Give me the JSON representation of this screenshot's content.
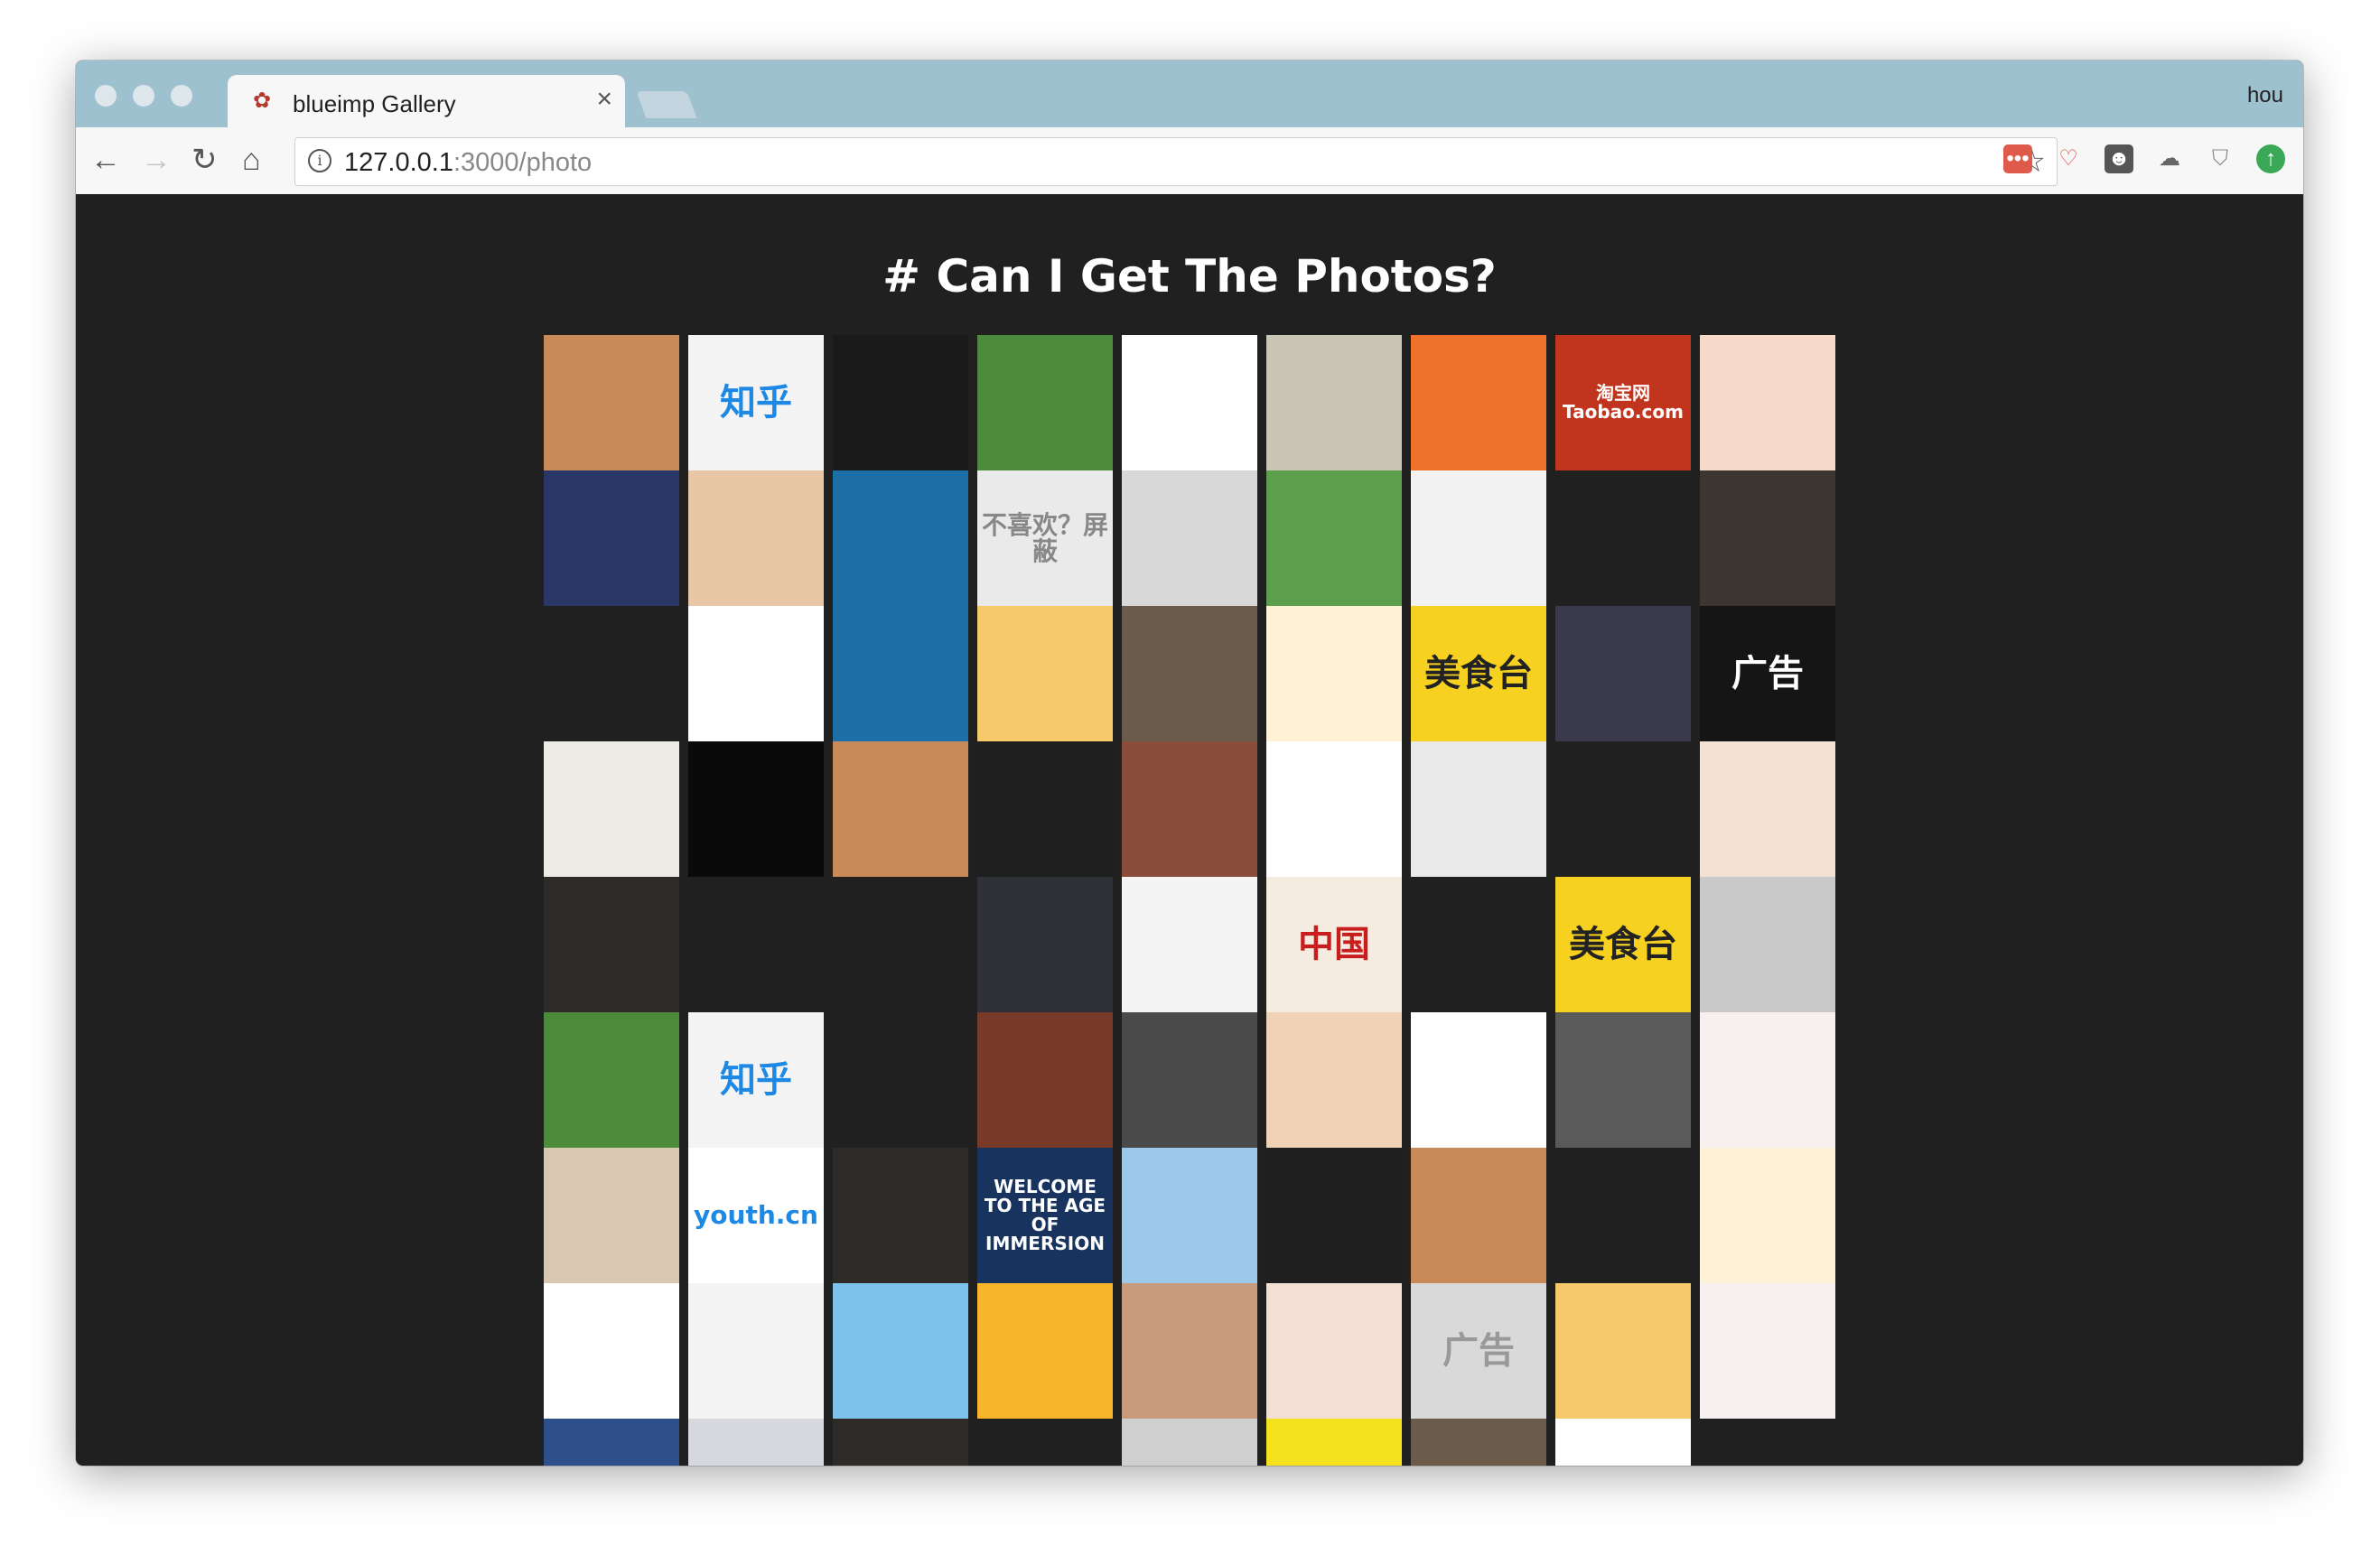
{
  "browser": {
    "tab_title": "blueimp Gallery",
    "tab_close": "×",
    "profile_name": "hou",
    "url_host": "127.0.0.1",
    "url_path": ":3000/photo",
    "nav": {
      "back": "←",
      "forward": "→",
      "reload": "↻",
      "home": "⌂"
    },
    "bookmark_star": "☆"
  },
  "page": {
    "heading": "# Can I Get The Photos?"
  },
  "gallery": [
    {
      "bg": "#c98a5a",
      "text": "",
      "color": "#fff"
    },
    {
      "bg": "#f4f4f4",
      "text": "知乎",
      "color": "#1e88e5"
    },
    {
      "bg": "#1a1a1a",
      "text": "",
      "color": "#fff"
    },
    {
      "bg": "#4c8b3b",
      "text": "",
      "color": "#fff"
    },
    {
      "bg": "#ffffff",
      "text": "",
      "color": "#f26b21"
    },
    {
      "bg": "#c9c6b8",
      "text": "",
      "color": "#fff"
    },
    {
      "bg": "#f0712b",
      "text": "",
      "color": "#fff"
    },
    {
      "bg": "#c1351f",
      "text": "淘宝网 Taobao.com",
      "color": "#fff"
    },
    {
      "bg": "#f6d9c8",
      "text": "",
      "color": "#fff"
    },
    {
      "bg": "#2a3766",
      "text": "",
      "color": "#fff"
    },
    {
      "bg": "#e7c7a6",
      "text": "",
      "color": "#d44"
    },
    {
      "bg": "#1d6fa8",
      "text": "",
      "color": "#fff"
    },
    {
      "bg": "#eaeaea",
      "text": "不喜欢？屏蔽",
      "color": "#888"
    },
    {
      "bg": "#d8d8d8",
      "text": "",
      "color": "#fff"
    },
    {
      "bg": "#5b9e4c",
      "text": "",
      "color": "#fff"
    },
    {
      "bg": "#f2f2f2",
      "text": "",
      "color": "#fff"
    },
    {
      "bg": "#202020",
      "text": "",
      "color": "#fff"
    },
    {
      "bg": "#3d3530",
      "text": "",
      "color": "#fff"
    },
    {
      "bg": "#202020",
      "text": "",
      "color": "#fff"
    },
    {
      "bg": "#ffffff",
      "text": "",
      "color": "#d93a3a"
    },
    {
      "bg": "#1d6fa8",
      "text": "",
      "color": "#fff"
    },
    {
      "bg": "#f6c96a",
      "text": "",
      "color": "#fff"
    },
    {
      "bg": "#6b5b4a",
      "text": "",
      "color": "#fff"
    },
    {
      "bg": "#fdf2d5",
      "text": "",
      "color": "#f25a5a"
    },
    {
      "bg": "#f6d11f",
      "text": "美食台",
      "color": "#222"
    },
    {
      "bg": "#3a3a4a",
      "text": "",
      "color": "#fff"
    },
    {
      "bg": "#151515",
      "text": "广告",
      "color": "#fff"
    },
    {
      "bg": "#eeeae6",
      "text": "",
      "color": "#222"
    },
    {
      "bg": "#0a0a0a",
      "text": "",
      "color": "#fff"
    },
    {
      "bg": "#c98a5a",
      "text": "",
      "color": "#fff"
    },
    {
      "bg": "#1f1f1f",
      "text": "",
      "color": "#fff"
    },
    {
      "bg": "#8a4d3a",
      "text": "",
      "color": "#fff"
    },
    {
      "bg": "#ffffff",
      "text": "",
      "color": "#fff"
    },
    {
      "bg": "#e9e9e9",
      "text": "",
      "color": "#fff"
    },
    {
      "bg": "#202020",
      "text": "",
      "color": "#fff"
    },
    {
      "bg": "#f3e1d2",
      "text": "",
      "color": "#fff"
    },
    {
      "bg": "#2e2a28",
      "text": "",
      "color": "#fff"
    },
    {
      "bg": "#202020",
      "text": "",
      "color": "#f7c43a"
    },
    {
      "bg": "#202020",
      "text": "",
      "color": "#fff"
    },
    {
      "bg": "#2f3138",
      "text": "",
      "color": "#fff"
    },
    {
      "bg": "#f4f4f4",
      "text": "",
      "color": "#222"
    },
    {
      "bg": "#f4ece0",
      "text": "中国",
      "color": "#c81e1e"
    },
    {
      "bg": "#202020",
      "text": "",
      "color": "#fff"
    },
    {
      "bg": "#f6d11f",
      "text": "美食台",
      "color": "#222"
    },
    {
      "bg": "#c9c9c9",
      "text": "",
      "color": "#fff"
    },
    {
      "bg": "#4c8b3b",
      "text": "",
      "color": "#fff"
    },
    {
      "bg": "#f4f4f4",
      "text": "知乎",
      "color": "#1e88e5"
    },
    {
      "bg": "#202020",
      "text": "",
      "color": "#fff"
    },
    {
      "bg": "#7a3a2a",
      "text": "",
      "color": "#fff"
    },
    {
      "bg": "#4a4a4a",
      "text": "",
      "color": "#fff"
    },
    {
      "bg": "#f0d2b6",
      "text": "",
      "color": "#fff"
    },
    {
      "bg": "#ffffff",
      "text": "",
      "color": "#f26b21"
    },
    {
      "bg": "#5a5a5a",
      "text": "",
      "color": "#fff"
    },
    {
      "bg": "#f6f0ee",
      "text": "",
      "color": "#fff"
    },
    {
      "bg": "#d9c7b2",
      "text": "",
      "color": "#fff"
    },
    {
      "bg": "#ffffff",
      "text": "youth.cn",
      "color": "#1e88e5"
    },
    {
      "bg": "#2e2a28",
      "text": "",
      "color": "#fff"
    },
    {
      "bg": "#17335e",
      "text": "WELCOME TO THE AGE OF IMMERSION",
      "color": "#fff"
    },
    {
      "bg": "#9cc8ea",
      "text": "",
      "color": "#fff"
    },
    {
      "bg": "#1f1f1f",
      "text": "",
      "color": "#fff"
    },
    {
      "bg": "#c98a5a",
      "text": "",
      "color": "#fff"
    },
    {
      "bg": "#202020",
      "text": "",
      "color": "#fff"
    },
    {
      "bg": "#fdf2d5",
      "text": "",
      "color": "#f25a5a"
    },
    {
      "bg": "#ffffff",
      "text": "",
      "color": "#f26b21"
    },
    {
      "bg": "#f4f4f4",
      "text": "",
      "color": "#fff"
    },
    {
      "bg": "#7cc2ea",
      "text": "",
      "color": "#fff"
    },
    {
      "bg": "#f7b52a",
      "text": "",
      "color": "#fff"
    },
    {
      "bg": "#c79b7b",
      "text": "",
      "color": "#fff"
    },
    {
      "bg": "#f2dfd6",
      "text": "",
      "color": "#fff"
    },
    {
      "bg": "#d9d9d9",
      "text": "广告",
      "color": "#999"
    },
    {
      "bg": "#f6c96a",
      "text": "",
      "color": "#fff"
    },
    {
      "bg": "#f6f0ee",
      "text": "",
      "color": "#fff"
    },
    {
      "bg": "#2e4f8a",
      "text": "",
      "color": "#fff"
    },
    {
      "bg": "#d6d8dd",
      "text": "",
      "color": "#fff"
    },
    {
      "bg": "#2e2a28",
      "text": "",
      "color": "#fff"
    },
    {
      "bg": "#202020",
      "text": "",
      "color": "#fff"
    },
    {
      "bg": "#cfcfcf",
      "text": "",
      "color": "#fff"
    },
    {
      "bg": "#f4e21f",
      "text": "",
      "color": "#fff"
    },
    {
      "bg": "#6b5b4a",
      "text": "",
      "color": "#fff"
    },
    {
      "bg": "#ffffff",
      "text": "",
      "color": "#000"
    },
    {
      "bg": "#202020",
      "text": "",
      "color": "#fff"
    }
  ]
}
